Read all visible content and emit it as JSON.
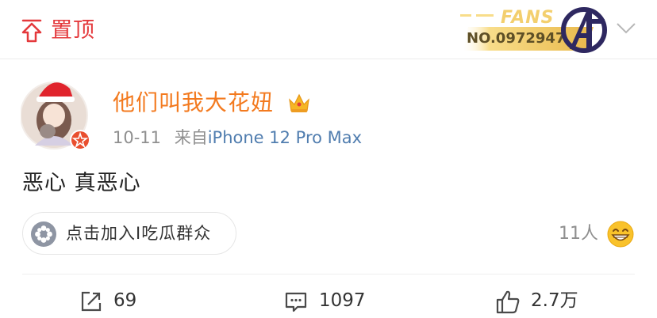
{
  "pin": {
    "label": "置顶",
    "icon": "pin-top-icon"
  },
  "fan_badge": {
    "title": "FANS",
    "number": "NO.0972947",
    "icon": "avengers-logo"
  },
  "header": {
    "more_icon": "chevron-down-icon"
  },
  "post": {
    "author": "他们叫我大花妞",
    "author_badge_icon": "crown-icon",
    "date": "10-11",
    "source_prefix": "来自",
    "device": "iPhone 12 Pro Max",
    "text": "恶心 真恶心"
  },
  "group": {
    "label": "点击加入I吃瓜群众",
    "icon": "group-icon"
  },
  "reactions": {
    "count": "11人",
    "emoji": "grinning-emoji-icon"
  },
  "actions": {
    "repost": {
      "count": "69",
      "icon": "repost-icon"
    },
    "comment": {
      "count": "1097",
      "icon": "comment-icon"
    },
    "like": {
      "count": "2.7万",
      "icon": "thumbs-up-icon"
    }
  },
  "colors": {
    "pin": "#e4393c",
    "author": "#f37a1f",
    "meta": "#8f8f8f",
    "device": "#507daf",
    "badge_gold": "#f4d27a",
    "verified": "#e94f2f"
  }
}
